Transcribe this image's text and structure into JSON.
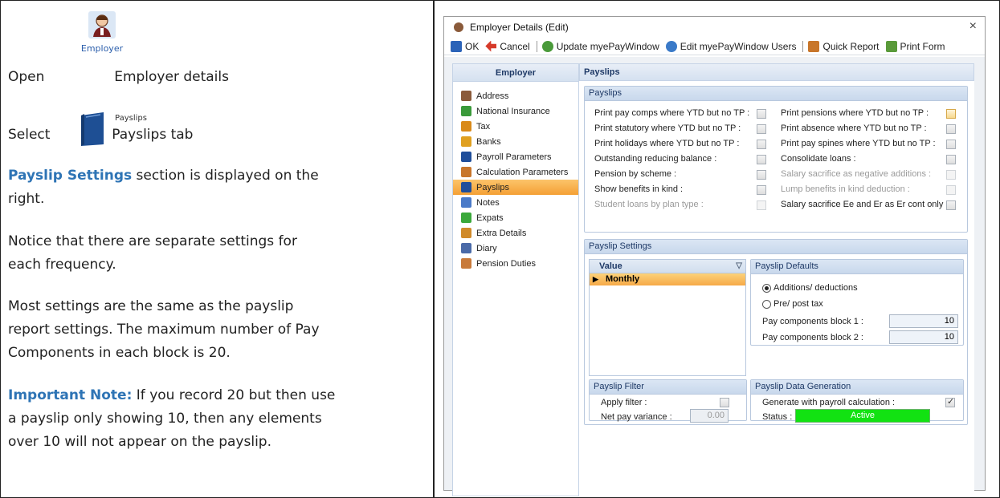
{
  "doc": {
    "open_word": "Open",
    "employer_ribbon_label": "Employer",
    "open_rest": "Employer details",
    "select_word": "Select",
    "payslips_ribbon_label": "Payslips",
    "select_rest": "Payslips tab",
    "p3_accent": "Payslip Settings",
    "p3_line1_rest": " section is displayed on the",
    "p3_line2": "right.",
    "p4_line1": "Notice that there are separate settings for",
    "p4_line2": "each frequency.",
    "p5_line1": "Most settings are the same as the payslip",
    "p5_line2": "report settings.  The maximum number of Pay",
    "p5_line3": "Components in each block is 20.",
    "p6_accent": "Important Note:",
    "p6_line1_rest": " If you record 20 but then use",
    "p6_line2": "a payslip only showing 10, then any elements",
    "p6_line3": "over 10 will not appear on the payslip."
  },
  "window": {
    "title": "Employer Details (Edit)",
    "close_glyph": "×",
    "toolbar": {
      "ok": "OK",
      "cancel": "Cancel",
      "update": "Update myePayWindow",
      "edit_users": "Edit myePayWindow Users",
      "quick_report": "Quick Report",
      "print_form": "Print Form"
    },
    "nav": {
      "header": "Employer",
      "items": [
        {
          "label": "Address",
          "icon": "person-icon",
          "color": "#8a5a3a"
        },
        {
          "label": "National Insurance",
          "icon": "ni-icon",
          "color": "#3a9a3a"
        },
        {
          "label": "Tax",
          "icon": "tax-icon",
          "color": "#d98a1a"
        },
        {
          "label": "Banks",
          "icon": "bank-icon",
          "color": "#e0a020"
        },
        {
          "label": "Payroll Parameters",
          "icon": "book-icon",
          "color": "#1f4e9a"
        },
        {
          "label": "Calculation Parameters",
          "icon": "calc-icon",
          "color": "#c8762a"
        },
        {
          "label": "Payslips",
          "icon": "payslips-icon",
          "color": "#1f4e9a"
        },
        {
          "label": "Notes",
          "icon": "notes-icon",
          "color": "#4a7ac8"
        },
        {
          "label": "Expats",
          "icon": "globe-icon",
          "color": "#3aa83a"
        },
        {
          "label": "Extra Details",
          "icon": "people-icon",
          "color": "#d08a2a"
        },
        {
          "label": "Diary",
          "icon": "diary-icon",
          "color": "#4a6aa8"
        },
        {
          "label": "Pension Duties",
          "icon": "pension-icon",
          "color": "#c87a3a"
        }
      ]
    },
    "content_header": "Payslips",
    "payslips_group": {
      "title": "Payslips",
      "left": [
        {
          "label": "Print pay comps where YTD but no TP :",
          "dim": false
        },
        {
          "label": "Print statutory where YTD but no TP :",
          "dim": false
        },
        {
          "label": "Print holidays where YTD but no TP :",
          "dim": false
        },
        {
          "label": "Outstanding reducing balance :",
          "dim": false
        },
        {
          "label": "Pension by scheme :",
          "dim": false
        },
        {
          "label": "Show benefits in kind :",
          "dim": false
        },
        {
          "label": "Student loans by plan type :",
          "dim": true
        }
      ],
      "right": [
        {
          "label": "Print pensions where YTD but no TP :",
          "dim": false
        },
        {
          "label": "Print absence where YTD but no TP :",
          "dim": false
        },
        {
          "label": "Print pay spines where YTD but no TP :",
          "dim": false
        },
        {
          "label": "Consolidate loans :",
          "dim": false
        },
        {
          "label": "Salary sacrifice as negative additions :",
          "dim": true
        },
        {
          "label": "Lump benefits in kind deduction :",
          "dim": true
        },
        {
          "label": "Salary sacrifice Ee and Er as Er cont only :",
          "dim": false
        }
      ]
    },
    "payslip_settings": {
      "title": "Payslip Settings",
      "grid_header": "Value",
      "grid_row": "Monthly",
      "defaults": {
        "title": "Payslip Defaults",
        "radio1": "Additions/ deductions",
        "radio2": "Pre/ post tax",
        "block1_label": "Pay components block 1 :",
        "block1_value": "10",
        "block2_label": "Pay components block 2 :",
        "block2_value": "10"
      },
      "filter": {
        "title": "Payslip Filter",
        "apply_label": "Apply filter :",
        "variance_label": "Net pay variance :",
        "variance_value": "0.00"
      },
      "generation": {
        "title": "Payslip Data Generation",
        "generate_label": "Generate with payroll calculation :",
        "status_label": "Status :",
        "status_value": "Active"
      }
    }
  },
  "colors": {
    "accent": "#2e74b5",
    "active_nav": "#f4a035",
    "status_green": "#12e212"
  }
}
